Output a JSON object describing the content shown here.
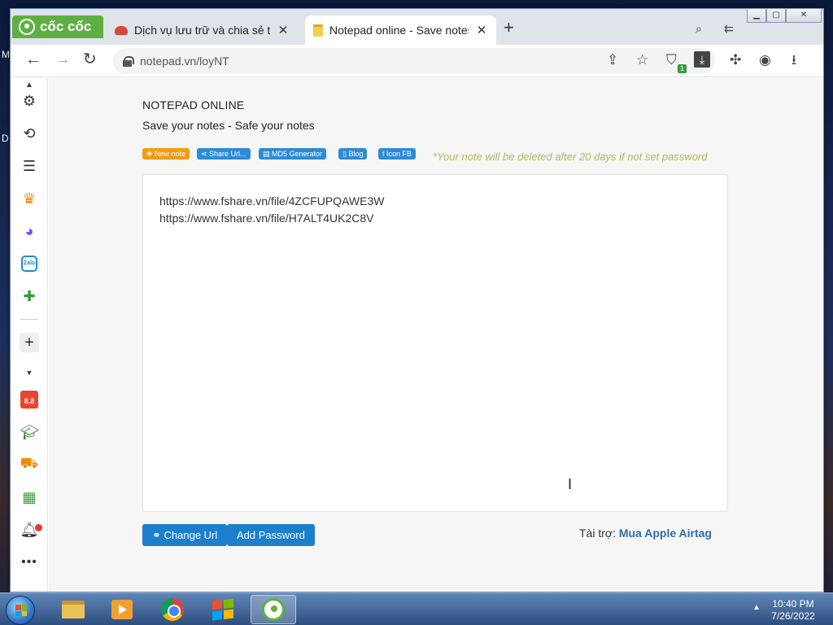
{
  "desktop": {
    "edge_text_top": "M",
    "edge_text_mid": "D"
  },
  "browser": {
    "brand": "cốc cốc",
    "tabs": [
      {
        "title": "Dịch vụ lưu trữ và chia sẻ trực",
        "icon": "cloud-icon",
        "active": false
      },
      {
        "title": "Notepad online - Save notes",
        "icon": "notepad-icon",
        "active": true
      }
    ],
    "new_tab_label": "+",
    "address": "notepad.vn/loyNT",
    "extension_badge": "1",
    "window_controls": [
      "minimize",
      "maximize",
      "close"
    ]
  },
  "sidebar": {
    "items": [
      "settings-icon",
      "history-icon",
      "list-icon",
      "crown-icon",
      "messenger-icon",
      "zalo-icon",
      "gamepad-icon",
      "add-icon",
      "sale-icon",
      "graduation-icon",
      "shopping-icon",
      "spreadsheet-icon",
      "bell-icon",
      "more-icon"
    ],
    "zalo_label": "Zalo",
    "sale_label": "8.8"
  },
  "page": {
    "title": "NOTEPAD ONLINE",
    "subtitle": "Save your notes - Safe your notes",
    "toolbar": {
      "new_note": "New note",
      "share_url": "Share Url...",
      "md5": "MD5 Generator",
      "blog": "Blog",
      "icon_fb": "Icon FB"
    },
    "warning": "*Your note will be deleted after 20 days if not set password",
    "note_lines": [
      "https://www.fshare.vn/file/4ZCFUPQAWE3W",
      "https://www.fshare.vn/file/H7ALT4UK2C8V"
    ],
    "change_url_label": "Change Url",
    "add_password_label": "Add Password",
    "sponsor_label": "Tài trợ:",
    "sponsor_link": "Mua Apple Airtag"
  },
  "taskbar": {
    "apps": [
      "file-explorer-icon",
      "media-player-icon",
      "chrome-icon",
      "windows-logo-icon",
      "coccoc-icon"
    ],
    "time": "10:40 PM",
    "date": "7/26/2022"
  },
  "colors": {
    "accent_blue": "#1c7fcc",
    "brand_green": "#5fb043",
    "warning_text": "#b8b45a",
    "new_note_orange": "#f39c12"
  }
}
